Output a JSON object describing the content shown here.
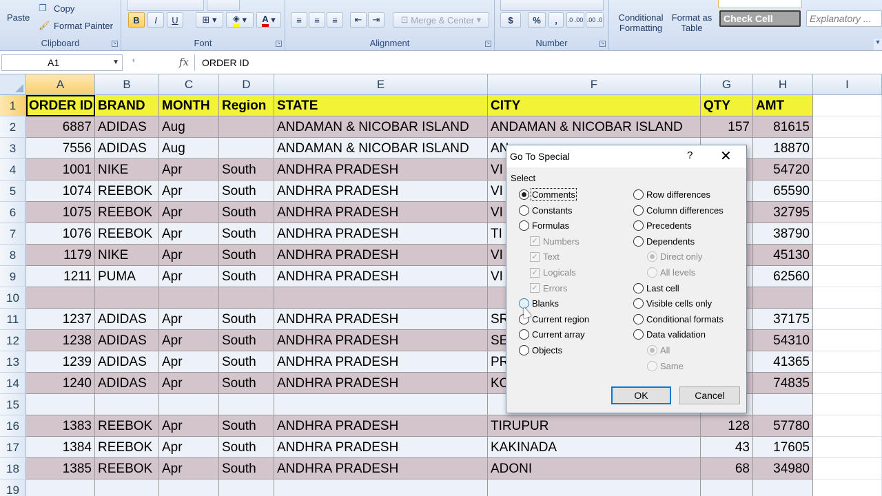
{
  "ribbon": {
    "clipboard": {
      "paste": "Paste",
      "copy": "Copy",
      "format_painter": "Format Painter",
      "label": "Clipboard"
    },
    "font": {
      "bold": "B",
      "italic": "I",
      "underline": "U",
      "label": "Font"
    },
    "alignment": {
      "merge_center": "Merge & Center",
      "label": "Alignment"
    },
    "number": {
      "currency": "$",
      "percent": "%",
      "comma": ",",
      "increase_decimal": ".0 .00",
      "decrease_decimal": ".00 .0",
      "label": "Number"
    },
    "styles": {
      "conditional_formatting": "Conditional Formatting",
      "format_as_table": "Format as Table",
      "check_cell": "Check Cell",
      "explanatory": "Explanatory ..."
    }
  },
  "formula_bar": {
    "name_box": "A1",
    "fx": "fx",
    "content": "ORDER ID"
  },
  "grid": {
    "columns": [
      "A",
      "B",
      "C",
      "D",
      "E",
      "F",
      "G",
      "H",
      "I"
    ],
    "rows": [
      {
        "n": "1",
        "cells": [
          "ORDER ID",
          "BRAND",
          "MONTH",
          "Region",
          "STATE",
          "CITY",
          "QTY",
          "AMT"
        ]
      },
      {
        "n": "2",
        "cells": [
          "6887",
          "ADIDAS",
          "Aug",
          "",
          "ANDAMAN & NICOBAR ISLAND",
          "ANDAMAN & NICOBAR ISLAND",
          "157",
          "81615"
        ]
      },
      {
        "n": "3",
        "cells": [
          "7556",
          "ADIDAS",
          "Aug",
          "",
          "ANDAMAN & NICOBAR ISLAND",
          "AN",
          "",
          "18870"
        ]
      },
      {
        "n": "4",
        "cells": [
          "1001",
          "NIKE",
          "Apr",
          "South",
          "ANDHRA PRADESH",
          "VI",
          "",
          "54720"
        ]
      },
      {
        "n": "5",
        "cells": [
          "1074",
          "REEBOK",
          "Apr",
          "South",
          "ANDHRA PRADESH",
          "VI",
          "",
          "65590"
        ]
      },
      {
        "n": "6",
        "cells": [
          "1075",
          "REEBOK",
          "Apr",
          "South",
          "ANDHRA PRADESH",
          "VI",
          "",
          "32795"
        ]
      },
      {
        "n": "7",
        "cells": [
          "1076",
          "REEBOK",
          "Apr",
          "South",
          "ANDHRA PRADESH",
          "TI",
          "",
          "38790"
        ]
      },
      {
        "n": "8",
        "cells": [
          "1179",
          "NIKE",
          "Apr",
          "South",
          "ANDHRA PRADESH",
          "VI",
          "",
          "45130"
        ]
      },
      {
        "n": "9",
        "cells": [
          "1211",
          "PUMA",
          "Apr",
          "South",
          "ANDHRA PRADESH",
          "VI",
          "",
          "62560"
        ]
      },
      {
        "n": "10",
        "cells": [
          "",
          "",
          "",
          "",
          "",
          "",
          "",
          ""
        ]
      },
      {
        "n": "11",
        "cells": [
          "1237",
          "ADIDAS",
          "Apr",
          "South",
          "ANDHRA PRADESH",
          "SR",
          "",
          "37175"
        ]
      },
      {
        "n": "12",
        "cells": [
          "1238",
          "ADIDAS",
          "Apr",
          "South",
          "ANDHRA PRADESH",
          "SE",
          "",
          "54310"
        ]
      },
      {
        "n": "13",
        "cells": [
          "1239",
          "ADIDAS",
          "Apr",
          "South",
          "ANDHRA PRADESH",
          "PR",
          "",
          "41365"
        ]
      },
      {
        "n": "14",
        "cells": [
          "1240",
          "ADIDAS",
          "Apr",
          "South",
          "ANDHRA PRADESH",
          "KO",
          "",
          "74835"
        ]
      },
      {
        "n": "15",
        "cells": [
          "",
          "",
          "",
          "",
          "",
          "",
          "",
          ""
        ]
      },
      {
        "n": "16",
        "cells": [
          "1383",
          "REEBOK",
          "Apr",
          "South",
          "ANDHRA PRADESH",
          "TIRUPUR",
          "128",
          "57780"
        ]
      },
      {
        "n": "17",
        "cells": [
          "1384",
          "REEBOK",
          "Apr",
          "South",
          "ANDHRA PRADESH",
          "KAKINADA",
          "43",
          "17605"
        ]
      },
      {
        "n": "18",
        "cells": [
          "1385",
          "REEBOK",
          "Apr",
          "South",
          "ANDHRA PRADESH",
          "ADONI",
          "68",
          "34980"
        ]
      },
      {
        "n": "19",
        "cells": [
          "",
          "",
          "",
          "",
          "",
          "",
          "",
          ""
        ]
      }
    ]
  },
  "dialog": {
    "title": "Go To Special",
    "help": "?",
    "close": "✕",
    "section": "Select",
    "left_options": [
      {
        "label": "Comments",
        "kind": "radio",
        "checked": true
      },
      {
        "label": "Constants",
        "kind": "radio"
      },
      {
        "label": "Formulas",
        "kind": "radio"
      },
      {
        "label": "Numbers",
        "kind": "check",
        "disabled": true
      },
      {
        "label": "Text",
        "kind": "check",
        "disabled": true
      },
      {
        "label": "Logicals",
        "kind": "check",
        "disabled": true
      },
      {
        "label": "Errors",
        "kind": "check",
        "disabled": true
      },
      {
        "label": "Blanks",
        "kind": "radio",
        "hover": true
      },
      {
        "label": "Current region",
        "kind": "radio"
      },
      {
        "label": "Current array",
        "kind": "radio"
      },
      {
        "label": "Objects",
        "kind": "radio"
      }
    ],
    "right_options": [
      {
        "label": "Row differences",
        "kind": "radio"
      },
      {
        "label": "Column differences",
        "kind": "radio"
      },
      {
        "label": "Precedents",
        "kind": "radio"
      },
      {
        "label": "Dependents",
        "kind": "radio"
      },
      {
        "label": "Direct only",
        "kind": "radio",
        "disabled": true,
        "checked": true
      },
      {
        "label": "All levels",
        "kind": "radio",
        "disabled": true
      },
      {
        "label": "Last cell",
        "kind": "radio"
      },
      {
        "label": "Visible cells only",
        "kind": "radio"
      },
      {
        "label": "Conditional formats",
        "kind": "radio"
      },
      {
        "label": "Data validation",
        "kind": "radio"
      },
      {
        "label": "All",
        "kind": "radio",
        "disabled": true,
        "checked": true
      },
      {
        "label": "Same",
        "kind": "radio",
        "disabled": true
      }
    ],
    "ok": "OK",
    "cancel": "Cancel"
  }
}
